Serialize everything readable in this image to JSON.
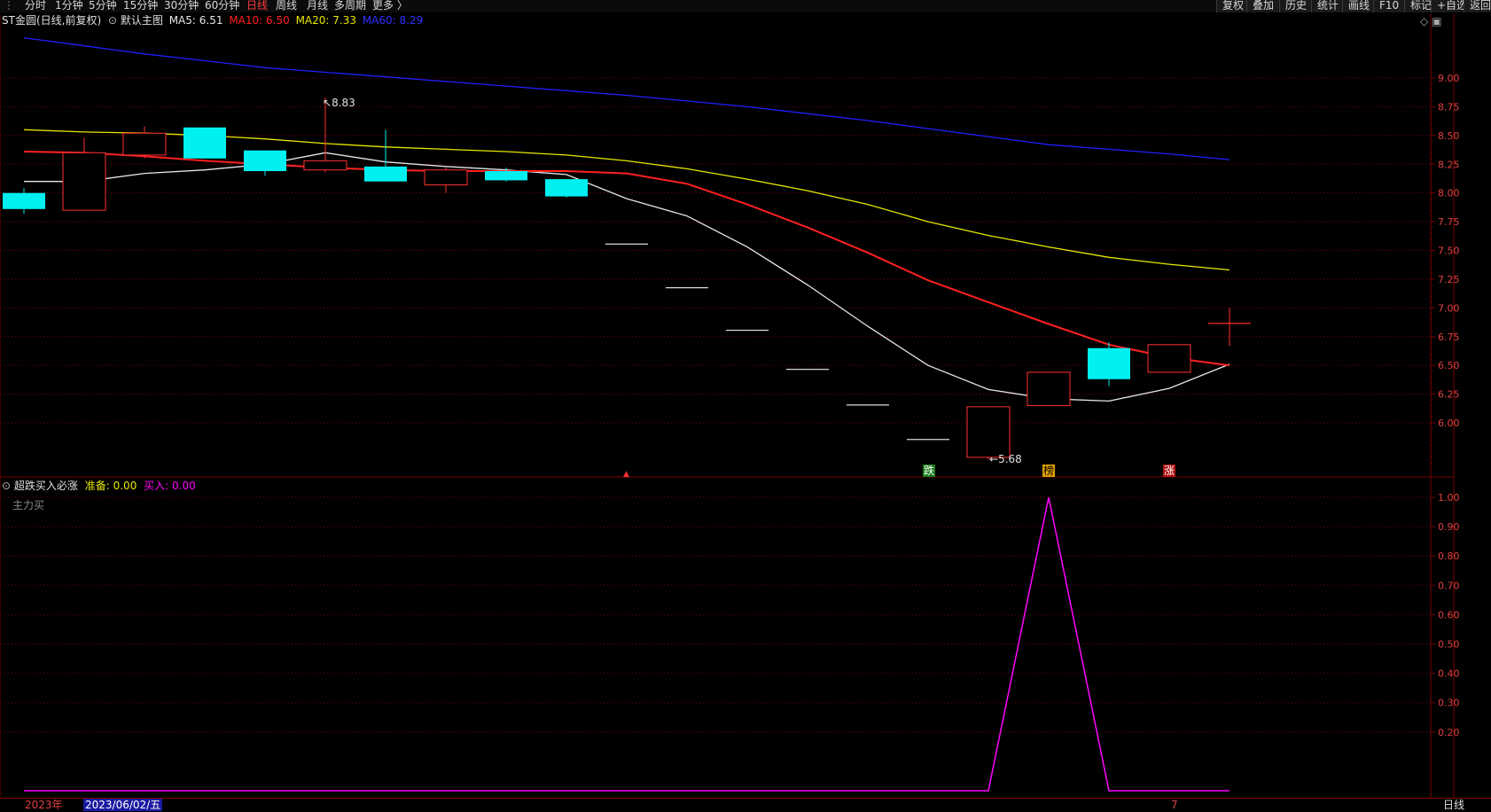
{
  "toolbar": {
    "periods": [
      "分时",
      "1分钟",
      "5分钟",
      "15分钟",
      "30分钟",
      "60分钟",
      "日线",
      "周线",
      "月线",
      "多周期",
      "更多 〉"
    ],
    "active_period": "日线",
    "right_buttons": [
      "复权",
      "叠加",
      "历史",
      "统计",
      "画线",
      "F10",
      "标记",
      "+自选",
      "返回"
    ]
  },
  "main_header": {
    "stock": "ST金圆",
    "mode": "(日线,前复权)",
    "chart_name": "默认主图",
    "ma5_label": "MA5:",
    "ma5_value": "6.51",
    "ma10_label": "MA10:",
    "ma10_value": "6.50",
    "ma20_label": "MA20:",
    "ma20_value": "7.33",
    "ma60_label": "MA60:",
    "ma60_value": "8.29"
  },
  "sub_header": {
    "indicator": "超跌买入必涨",
    "ready_label": "准备:",
    "ready_value": "0.00",
    "buy_label": "买入:",
    "buy_value": "0.00",
    "signal_name": "主力买"
  },
  "annotations": {
    "high_label": "8.83",
    "low_label": "5.68",
    "marker_die": "跌",
    "marker_bang": "榜",
    "marker_zhang": "涨"
  },
  "bottom": {
    "year": "2023年",
    "cursor_date": "2023/06/02/五",
    "month_mark": "7",
    "period_label": "日线"
  },
  "colors": {
    "up": "#ff3030",
    "down": "#00f0f0",
    "ma5": "#e6e6e6",
    "ma10": "#ff2020",
    "ma20": "#e6e600",
    "ma60": "#2020ff",
    "indicator": "#ff00ff",
    "grid": "#7a0000"
  },
  "chart_data": [
    {
      "type": "candlestick",
      "title": "ST金圆 (日线,前复权)",
      "y_ticks": [
        "9.00",
        "8.75",
        "8.50",
        "8.25",
        "8.00",
        "7.75",
        "7.50",
        "7.25",
        "7.00",
        "6.75",
        "6.50",
        "6.25",
        "6.00"
      ],
      "ylim": [
        5.55,
        9.3
      ],
      "candles": [
        {
          "open": 8.0,
          "close": 7.86,
          "high": 8.04,
          "low": 7.82
        },
        {
          "open": 7.85,
          "close": 8.35,
          "high": 8.48,
          "low": 7.85
        },
        {
          "open": 8.33,
          "close": 8.52,
          "high": 8.58,
          "low": 8.3
        },
        {
          "open": 8.57,
          "close": 8.3,
          "high": 8.57,
          "low": 8.3
        },
        {
          "open": 8.37,
          "close": 8.19,
          "high": 8.37,
          "low": 8.15
        },
        {
          "open": 8.2,
          "close": 8.28,
          "high": 8.83,
          "low": 8.18
        },
        {
          "open": 8.23,
          "close": 8.1,
          "high": 8.55,
          "low": 8.1
        },
        {
          "open": 8.07,
          "close": 8.2,
          "high": 8.22,
          "low": 8.0
        },
        {
          "open": 8.19,
          "close": 8.11,
          "high": 8.22,
          "low": 8.1
        },
        {
          "open": 8.12,
          "close": 7.97,
          "high": 8.12,
          "low": 7.96
        },
        {
          "open": 7.56,
          "close": 7.56,
          "high": 7.56,
          "low": 7.56
        },
        {
          "open": 7.18,
          "close": 7.18,
          "high": 7.18,
          "low": 7.18
        },
        {
          "open": 6.81,
          "close": 6.81,
          "high": 6.81,
          "low": 6.81
        },
        {
          "open": 6.47,
          "close": 6.47,
          "high": 6.47,
          "low": 6.47
        },
        {
          "open": 6.16,
          "close": 6.16,
          "high": 6.16,
          "low": 6.16
        },
        {
          "open": 5.86,
          "close": 5.86,
          "high": 5.86,
          "low": 5.86
        },
        {
          "open": 5.7,
          "close": 6.14,
          "high": 6.14,
          "low": 5.68
        },
        {
          "open": 6.15,
          "close": 6.44,
          "high": 6.44,
          "low": 6.15
        },
        {
          "open": 6.65,
          "close": 6.38,
          "high": 6.7,
          "low": 6.32
        },
        {
          "open": 6.44,
          "close": 6.68,
          "high": 6.68,
          "low": 6.44
        },
        {
          "open": 6.87,
          "close": 6.87,
          "high": 7.0,
          "low": 6.67
        }
      ],
      "series": [
        {
          "name": "MA5",
          "values": [
            8.1,
            8.1,
            8.17,
            8.2,
            8.25,
            8.35,
            8.27,
            8.23,
            8.2,
            8.16,
            7.95,
            7.8,
            7.53,
            7.2,
            6.84,
            6.5,
            6.29,
            6.21,
            6.19,
            6.3,
            6.51
          ]
        },
        {
          "name": "MA10",
          "values": [
            8.36,
            8.35,
            8.32,
            8.28,
            8.25,
            8.22,
            8.2,
            8.19,
            8.19,
            8.19,
            8.17,
            8.08,
            7.9,
            7.7,
            7.48,
            7.24,
            7.05,
            6.86,
            6.68,
            6.57,
            6.5
          ]
        },
        {
          "name": "MA20",
          "values": [
            8.55,
            8.53,
            8.52,
            8.5,
            8.47,
            8.43,
            8.4,
            8.38,
            8.36,
            8.33,
            8.28,
            8.21,
            8.12,
            8.02,
            7.9,
            7.75,
            7.63,
            7.53,
            7.44,
            7.38,
            7.33
          ]
        },
        {
          "name": "MA60",
          "values": [
            9.35,
            9.28,
            9.21,
            9.15,
            9.09,
            9.05,
            9.01,
            8.97,
            8.93,
            8.89,
            8.85,
            8.8,
            8.75,
            8.69,
            8.63,
            8.56,
            8.49,
            8.42,
            8.38,
            8.34,
            8.29
          ]
        }
      ]
    },
    {
      "type": "line",
      "title": "超跌买入必涨",
      "y_ticks": [
        "1.00",
        "0.90",
        "0.80",
        "0.70",
        "0.60",
        "0.50",
        "0.40",
        "0.30",
        "0.20"
      ],
      "ylim": [
        0.0,
        1.05
      ],
      "series": [
        {
          "name": "主力买",
          "values": [
            0,
            0,
            0,
            0,
            0,
            0,
            0,
            0,
            0,
            0,
            0,
            0,
            0,
            0,
            0,
            0,
            0,
            1,
            0,
            0,
            0
          ]
        }
      ]
    }
  ]
}
